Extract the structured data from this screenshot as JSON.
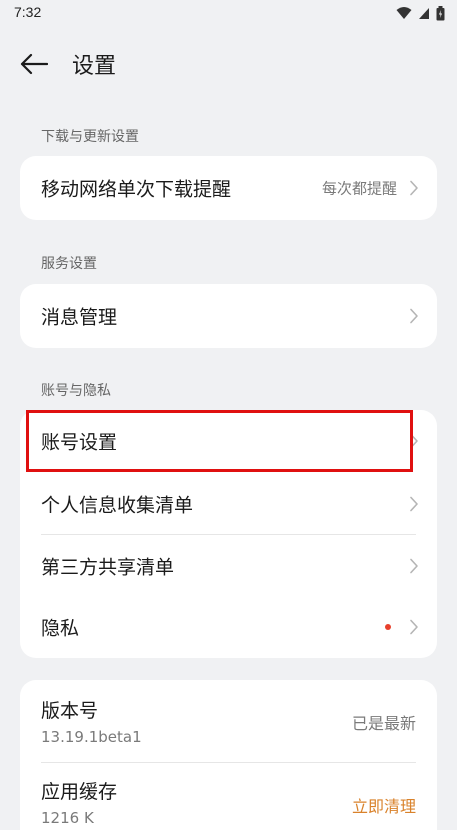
{
  "status": {
    "time": "7:32"
  },
  "header": {
    "title": "设置"
  },
  "sections": {
    "download": {
      "label": "下载与更新设置",
      "items": [
        {
          "label": "移动网络单次下载提醒",
          "value": "每次都提醒"
        }
      ]
    },
    "service": {
      "label": "服务设置",
      "items": [
        {
          "label": "消息管理"
        }
      ]
    },
    "account": {
      "label": "账号与隐私",
      "items": [
        {
          "label": "账号设置"
        },
        {
          "label": "个人信息收集清单"
        },
        {
          "label": "第三方共享清单"
        },
        {
          "label": "隐私"
        }
      ]
    },
    "about": {
      "version_label": "版本号",
      "version_value": "13.19.1beta1",
      "version_status": "已是最新",
      "cache_label": "应用缓存",
      "cache_value": "1216 K",
      "cache_action": "立即清理"
    }
  },
  "colors": {
    "accent": "#d9822b",
    "highlight": "#e01010",
    "dot": "#e8402c"
  }
}
